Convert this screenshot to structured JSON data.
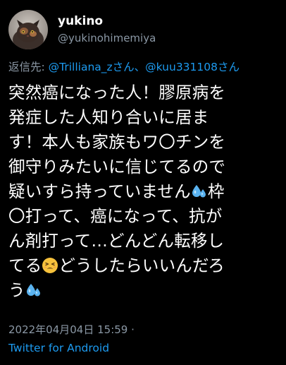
{
  "user": {
    "display_name": "yukino",
    "handle": "@yukinohimemiya"
  },
  "reply": {
    "prefix": "返信先: ",
    "mention_1": "@Trilliana_zさん",
    "separator": "、",
    "mention_2": "@kuu331108さん"
  },
  "body": {
    "line_1": "突然癌になった人！膠原病を",
    "line_2": "発症した人知り合いに居ま",
    "line_3": "す！本人も家族もワ〇チンを",
    "line_4": "御守りみたいに信じてるので",
    "line_5a": "疑いすら持っていません",
    "line_5b": "枠",
    "line_6": "〇打って、癌になって、抗が",
    "line_7": "ん剤打って…どんどん転移し",
    "line_8a": "てる",
    "line_8b": "どうしたらいいんだろ",
    "line_9": "う"
  },
  "emojis": {
    "sweat_droplets": "sweat-droplets-icon",
    "tired_face": "tired-face-icon"
  },
  "meta": {
    "timestamp": "2022年04月04日 15:59 ·"
  },
  "source": {
    "label": "Twitter for Android"
  },
  "colors": {
    "background": "#000000",
    "text": "#ffffff",
    "secondary": "#8b98a5",
    "link": "#1d9bf0",
    "droplet": "#5ab3f0",
    "face": "#f7c23c"
  }
}
